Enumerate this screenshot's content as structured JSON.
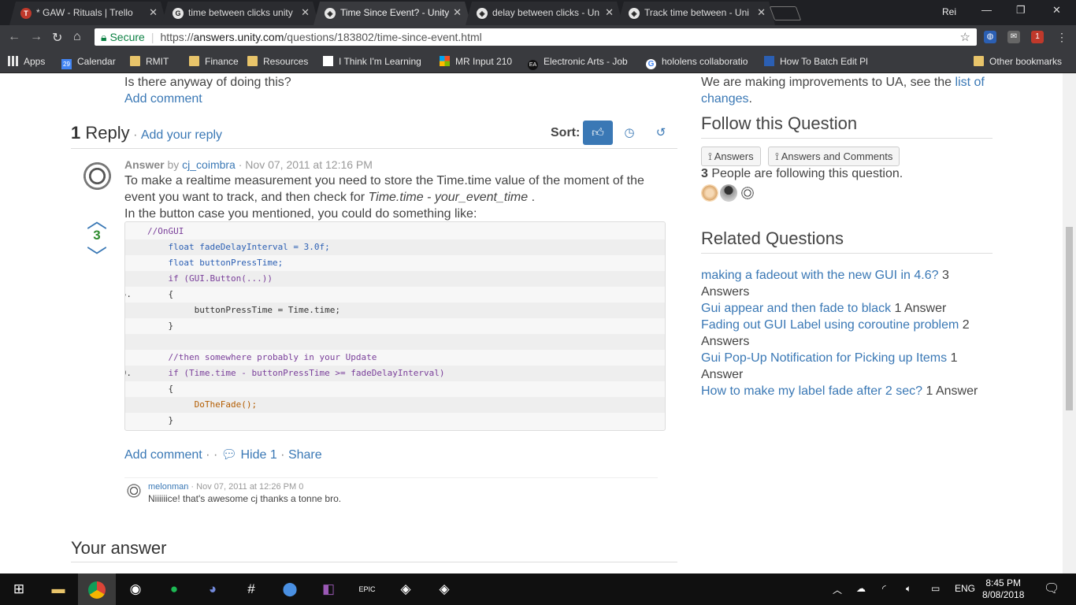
{
  "browser": {
    "tabs": [
      {
        "title": "* GAW - Rituals | Trello",
        "fav": "T",
        "fav_color": "#c0392b"
      },
      {
        "title": "time between clicks unity",
        "fav": "G",
        "fav_color": "#ffffff"
      },
      {
        "title": "Time Since Event? - Unity",
        "fav": "◈",
        "fav_color": "#ffffff"
      },
      {
        "title": "delay between clicks - Un",
        "fav": "◈",
        "fav_color": "#ffffff"
      },
      {
        "title": "Track time between - Uni",
        "fav": "◈",
        "fav_color": "#ffffff"
      }
    ],
    "user": "Rei",
    "secure_label": "Secure",
    "url_scheme": "https://",
    "url_host": "answers.unity.com",
    "url_path": "/questions/183802/time-since-event.html",
    "bookmarks": [
      {
        "label": "Apps",
        "icon": "apps-icon"
      },
      {
        "label": "Calendar",
        "icon": "calendar-icon"
      },
      {
        "label": "RMIT",
        "icon": "folder-icon"
      },
      {
        "label": "Finance",
        "icon": "folder-icon"
      },
      {
        "label": "Resources",
        "icon": "folder-icon"
      },
      {
        "label": "I Think I'm Learning",
        "icon": "bookmark-icon"
      },
      {
        "label": "MR Input 210",
        "icon": "microsoft-icon"
      },
      {
        "label": "Electronic Arts - Job",
        "icon": "ea-icon"
      },
      {
        "label": "hololens collaboratio",
        "icon": "google-icon"
      },
      {
        "label": "How To Batch Edit Pl",
        "icon": "bookmark-icon"
      }
    ],
    "other_bookmarks": "Other bookmarks",
    "calendar_day": "29",
    "extension_badge": "1"
  },
  "question": {
    "tail_text": "Is there anyway of doing this?",
    "add_comment": "Add comment"
  },
  "replies": {
    "count": "1",
    "label": "Reply",
    "add_reply": "Add your reply",
    "sort_label": "Sort:"
  },
  "answer": {
    "label": "Answer",
    "by": "by",
    "author": "cj_coimbra",
    "date": "· Nov 07, 2011 at 12:16 PM",
    "votes": "3",
    "p1": "To make a realtime measurement you need to store the Time.time value of the moment of the event you want to track, and then check for",
    "p1_em": "Time.time - your_event_time",
    "p1_end": ".",
    "p2": "In the button case you mentioned, you could do something like:",
    "code": [
      {
        "num": "",
        "text": "//OnGUI"
      },
      {
        "num": "",
        "text": "    float fadeDelayInterval = 3.0f;"
      },
      {
        "num": "",
        "text": "    float buttonPressTime;"
      },
      {
        "num": "",
        "text": "    if (GUI.Button(...))"
      },
      {
        "num": "5.",
        "text": "    {"
      },
      {
        "num": "",
        "text": "         buttonPressTime = Time.time;"
      },
      {
        "num": "",
        "text": "    }"
      },
      {
        "num": "",
        "text": ""
      },
      {
        "num": "",
        "text": "    //then somewhere probably in your Update"
      },
      {
        "num": "10.",
        "text": "    if (Time.time - buttonPressTime >= fadeDelayInterval)"
      },
      {
        "num": "",
        "text": "    {"
      },
      {
        "num": "",
        "text": "         DoTheFade();"
      },
      {
        "num": "",
        "text": "    }"
      }
    ],
    "add_comment": "Add comment",
    "hide": "Hide 1",
    "share": "Share"
  },
  "comment": {
    "author": "melonman",
    "date": "· Nov 07, 2011 at 12:26 PM",
    "votes": "0",
    "text": "Niiiiiice! that's awesome cj thanks a tonne bro."
  },
  "your_answer": "Your answer",
  "sidebar": {
    "notice": "We are making improvements to UA, see the",
    "notice_link": "list of changes",
    "notice_end": ".",
    "follow_title": "Follow this Question",
    "btn_answers": "Answers",
    "btn_answers_comments": "Answers and Comments",
    "followers_count": "3",
    "followers_text": "People are following this question.",
    "related_title": "Related Questions",
    "related": [
      {
        "title": "making a fadeout with the new GUI in 4.6?",
        "answers": "3 Answers"
      },
      {
        "title": "Gui appear and then fade to black",
        "answers": "1 Answer"
      },
      {
        "title": "Fading out GUI Label using coroutine problem",
        "answers": "2 Answers"
      },
      {
        "title": "Gui Pop-Up Notification for Picking up Items",
        "answers": "1 Answer"
      },
      {
        "title": "How to make my label fade after 2 sec?",
        "answers": "1 Answer"
      }
    ]
  },
  "taskbar": {
    "lang": "ENG",
    "time": "8:45 PM",
    "date": "8/08/2018"
  },
  "colors": {
    "link": "#3a78b5",
    "vote_count": "#2e8b2e",
    "secure": "#0b8043"
  }
}
